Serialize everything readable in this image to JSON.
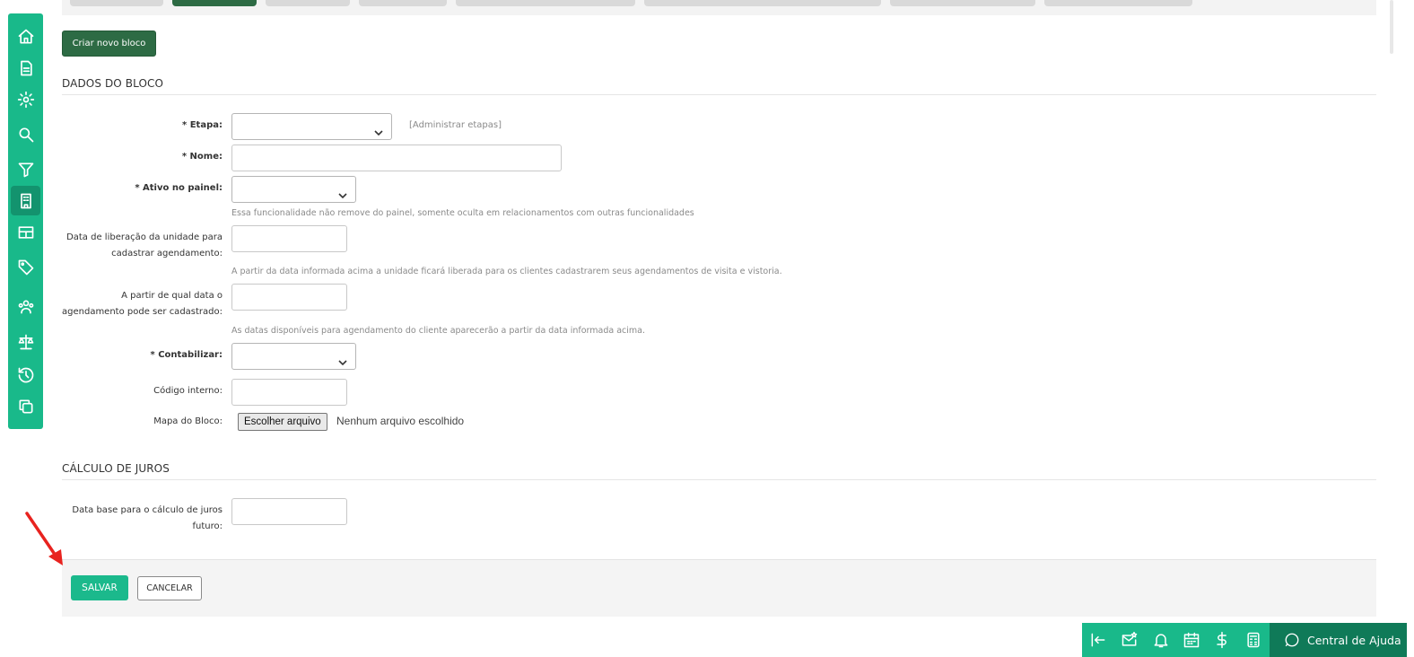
{
  "tabs": [
    "",
    "",
    "",
    "",
    "",
    "",
    "",
    ""
  ],
  "active_tab_index": 1,
  "create_button": "Criar novo bloco",
  "section_block": "DADOS DO BLOCO",
  "section_interest": "CÁLCULO DE JUROS",
  "fields": {
    "etapa": {
      "label": "* Etapa:",
      "value": ""
    },
    "admin_link": "[Administrar etapas]",
    "nome": {
      "label": "* Nome:",
      "value": ""
    },
    "ativo": {
      "label": "* Ativo no painel:",
      "value": "",
      "hint": "Essa funcionalidade não remove do painel, somente oculta em relacionamentos com outras funcionalidades"
    },
    "liberacao": {
      "label_1": "Data de liberação da unidade para",
      "label_2": "cadastrar agendamento:",
      "value": "",
      "hint": "A partir da data informada acima a unidade ficará liberada para os clientes cadastrarem seus agendamentos de visita e vistoria."
    },
    "agendamento": {
      "label_1": "A partir de qual data o",
      "label_2": "agendamento pode ser cadastrado:",
      "value": "",
      "hint": "As datas disponíveis para agendamento do cliente aparecerão a partir da data informada acima."
    },
    "contabilizar": {
      "label": "* Contabilizar:",
      "value": ""
    },
    "codigo": {
      "label": "Código interno:",
      "value": ""
    },
    "mapa": {
      "label": "Mapa do Bloco:",
      "button": "Escolher arquivo",
      "status": "Nenhum arquivo escolhido"
    },
    "juros": {
      "label_1": "Data base para o cálculo de juros",
      "label_2": "futuro:",
      "value": ""
    }
  },
  "save_button": "SALVAR",
  "cancel_button": "CANCELAR",
  "help_label": "Central de Ajuda",
  "colors": {
    "sidebar": "#19b98a",
    "dark_green": "#2d6b44",
    "save": "#1bb98c",
    "arrow": "#e8231f"
  },
  "sidebar_icons": [
    "home-icon",
    "document-icon",
    "settings-icon",
    "search-icon",
    "filter-icon",
    "building-icon",
    "table-icon",
    "tag-icon",
    "users-icon",
    "scale-icon",
    "history-icon",
    "copy-icon"
  ],
  "bottom_icons": [
    "collapse-icon",
    "mail-star-icon",
    "bell-icon",
    "calendar-icon",
    "dollar-icon",
    "calculator-icon"
  ]
}
